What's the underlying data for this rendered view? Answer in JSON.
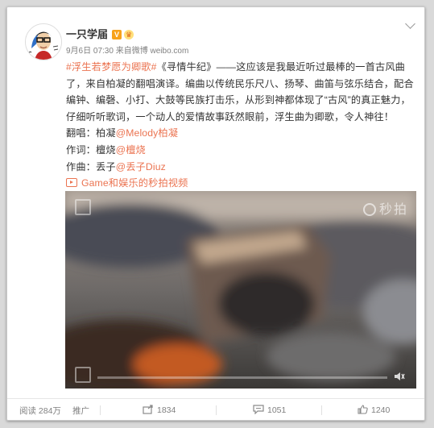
{
  "post": {
    "author": "一只学届",
    "verified_badge": "V",
    "member_badge": "♛",
    "timestamp": "9月6日 07:30",
    "source_prefix": "来自",
    "source": "微博 weibo.com",
    "paragraph": {
      "hashtag": "#浮生若梦愿为卿歌#",
      "body": "《寻情牛纪》——这应该是我最近听过最棒的一首古风曲了，来自柏凝的翻唱演译。编曲以传统民乐尺八、扬琴、曲笛与弦乐结合，配合编钟、编磬、小打、大鼓等民族打击乐，从形到神都体现了“古风”的真正魅力，仔细听听歌词，一个动人的爱情故事跃然眼前，浮生曲为卿歌，令人神往！"
    },
    "credits": [
      {
        "label": "翻唱：柏凝",
        "mention": "@Melody柏凝"
      },
      {
        "label": "作词：檀烧",
        "mention": "@檀烧"
      },
      {
        "label": "作曲：丢子",
        "mention": "@丢子Diuz"
      }
    ],
    "video_link": "Game和娱乐的秒拍视频",
    "video": {
      "watermark": "秒拍",
      "progress": 0
    }
  },
  "actions": {
    "reads": "阅读 284万",
    "promote": "推广",
    "reposts": "1834",
    "comments": "1051",
    "likes": "1240"
  },
  "colors": {
    "link": "#eb7350",
    "text": "#333333",
    "muted": "#808080",
    "progress": "#f6a623"
  },
  "icons": [
    "avatar-cartoon",
    "verified-icon",
    "member-crown-icon",
    "chevron-down-icon",
    "video-link-icon",
    "miaopai-logo-icon",
    "mute-icon",
    "repost-icon",
    "comment-icon",
    "like-icon"
  ]
}
